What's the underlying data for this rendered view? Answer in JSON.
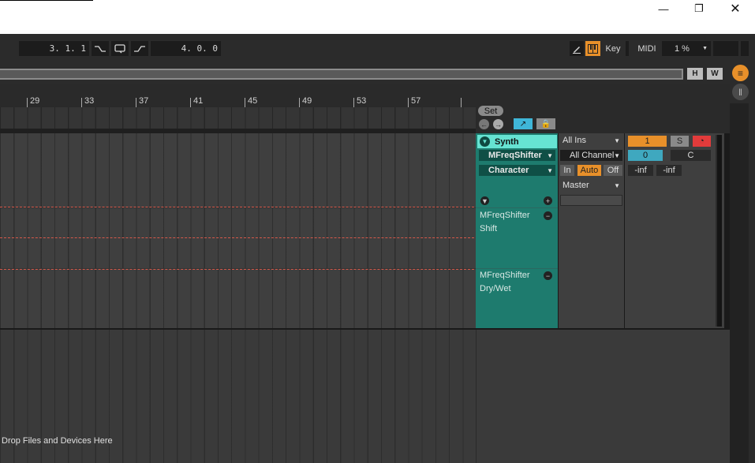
{
  "window": {
    "minimize_icon": "minimize-icon",
    "restore_icon": "restore-icon",
    "close_icon": "close-icon"
  },
  "transport": {
    "arrangement_position": "3.  1.  1",
    "loop_length": "4.  0.  0",
    "key_label": "Key",
    "midi_label": "MIDI",
    "cpu_load": "1 %"
  },
  "overview": {
    "h_label": "H",
    "w_label": "W"
  },
  "ruler": {
    "bars": [
      "29",
      "33",
      "37",
      "41",
      "45",
      "49",
      "53",
      "57"
    ]
  },
  "header": {
    "set_label": "Set"
  },
  "track": {
    "name": "Synth",
    "device_chooser": "MFreqShifter",
    "parameter_chooser": "Character",
    "lanes": [
      {
        "device": "MFreqShifter",
        "parameter": "Shift"
      },
      {
        "device": "MFreqShifter",
        "parameter": "Dry/Wet"
      }
    ],
    "input_type": "All Ins",
    "input_channel": "All Channels",
    "monitor": {
      "in": "In",
      "auto": "Auto",
      "off": "Off"
    },
    "output": "Master",
    "track_number": "1",
    "solo": "S",
    "volume": "0",
    "pan": "C",
    "peak_left": "-inf",
    "peak_right": "-inf"
  },
  "drop_area": {
    "text": "Drop Files and Devices Here"
  },
  "colors": {
    "accent_orange": "#e8902a",
    "track_teal": "#1e7b6e",
    "track_header": "#66e3d2",
    "automation_red": "#d6584a"
  }
}
